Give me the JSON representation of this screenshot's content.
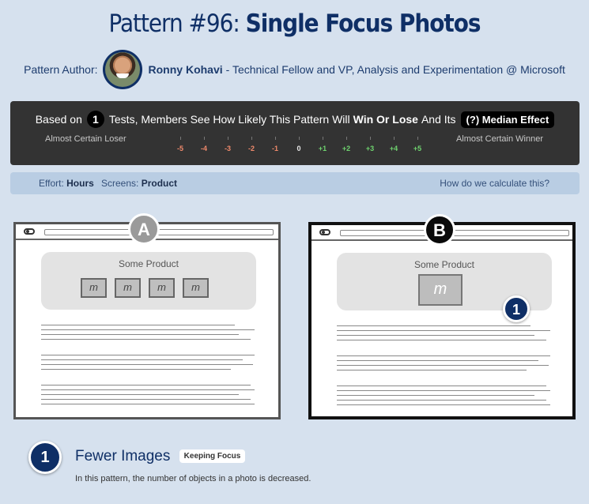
{
  "header": {
    "title_prefix": "Pattern #96:",
    "title_main": "Single Focus Photos"
  },
  "author": {
    "label": "Pattern Author:",
    "name": "Ronny Kohavi",
    "role": "- Technical Fellow and VP, Analysis and Experimentation @ Microsoft"
  },
  "test_summary": {
    "based_on": "Based on",
    "test_count": "1",
    "sentence_mid": "Tests, Members See How Likely This Pattern Will",
    "win_or_lose": "Win Or Lose",
    "sentence_end": "And Its",
    "median_label": "(?) Median Effect",
    "loser_label": "Almost Certain Loser",
    "winner_label": "Almost Certain Winner",
    "scale": [
      "-5",
      "-4",
      "-3",
      "-2",
      "-1",
      "0",
      "+1",
      "+2",
      "+3",
      "+4",
      "+5"
    ],
    "colors": {
      "negative": "#f08a6c",
      "neutral": "#e8e8e8",
      "positive": "#6fd36f"
    }
  },
  "info": {
    "effort_label": "Effort:",
    "effort_value": "Hours",
    "screens_label": "Screens:",
    "screens_value": "Product",
    "calc_link": "How do we calculate this?"
  },
  "variants": {
    "a": {
      "letter": "A",
      "product_name": "Some Product",
      "thumb_count": 4
    },
    "b": {
      "letter": "B",
      "product_name": "Some Product",
      "marker": "1"
    }
  },
  "finding": {
    "number": "1",
    "title": "Fewer Images",
    "tag": "Keeping Focus",
    "description": "In this pattern, the number of objects in a photo is decreased."
  }
}
